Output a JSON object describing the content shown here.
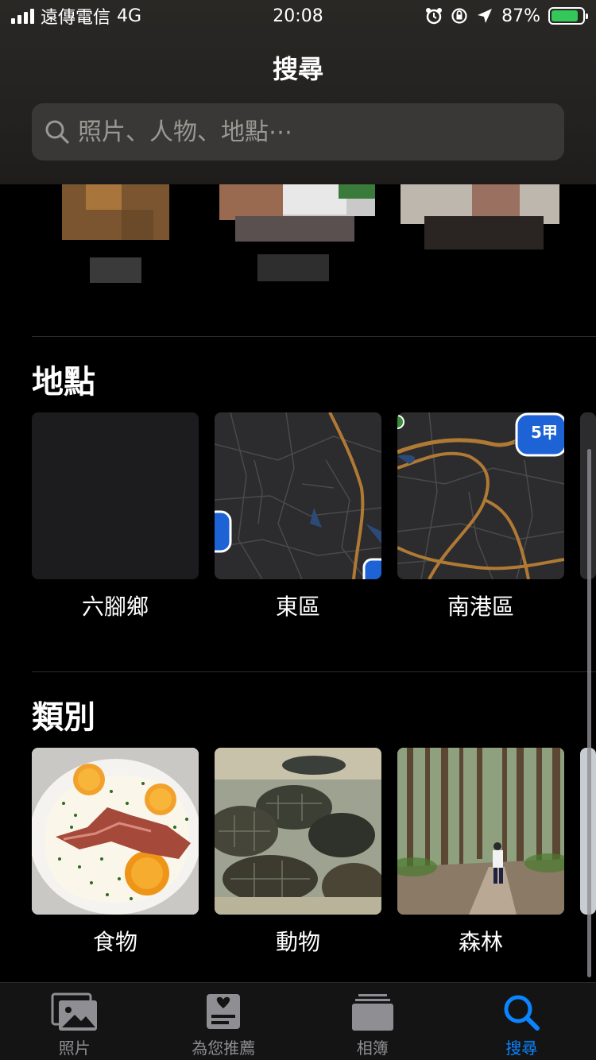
{
  "status_bar": {
    "carrier": "遠傳電信",
    "network": "4G",
    "time": "20:08",
    "battery": "87%",
    "battery_level": 0.87
  },
  "header": {
    "title": "搜尋",
    "search_placeholder": "照片、人物、地點⋯"
  },
  "places": {
    "title": "地點",
    "items": [
      {
        "label": "六腳鄉"
      },
      {
        "label": "東區"
      },
      {
        "label": "南港區"
      }
    ]
  },
  "categories": {
    "title": "類別",
    "items": [
      {
        "label": "食物"
      },
      {
        "label": "動物"
      },
      {
        "label": "森林"
      }
    ]
  },
  "tab_bar": {
    "tabs": [
      {
        "label": "照片",
        "icon": "photos-icon",
        "active": false
      },
      {
        "label": "為您推薦",
        "icon": "for-you-icon",
        "active": false
      },
      {
        "label": "相簿",
        "icon": "albums-icon",
        "active": false
      },
      {
        "label": "搜尋",
        "icon": "search-icon",
        "active": true
      }
    ]
  },
  "colors": {
    "accent": "#0a84ff",
    "battery_green": "#34c759",
    "map_road": "#b07a35",
    "map_background": "#2c2c2e"
  }
}
